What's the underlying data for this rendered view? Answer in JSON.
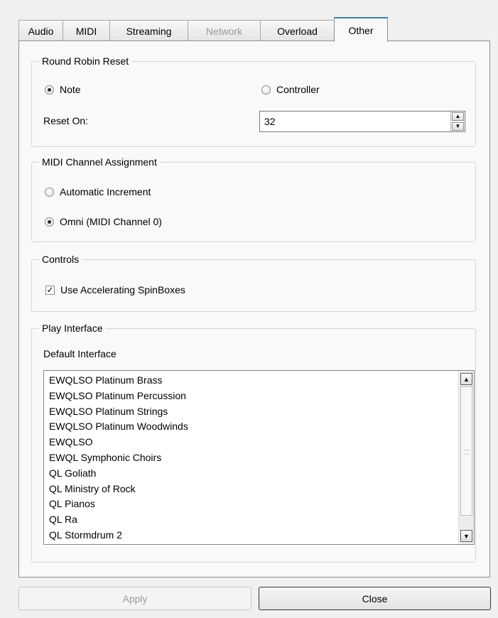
{
  "tabs": [
    {
      "label": "Audio",
      "state": "normal"
    },
    {
      "label": "MIDI",
      "state": "normal"
    },
    {
      "label": "Streaming",
      "state": "normal"
    },
    {
      "label": "Network",
      "state": "disabled"
    },
    {
      "label": "Overload",
      "state": "normal"
    },
    {
      "label": "Other",
      "state": "active"
    }
  ],
  "round_robin": {
    "title": "Round Robin Reset",
    "note_label": "Note",
    "note_selected": true,
    "controller_label": "Controller",
    "controller_selected": false,
    "reset_on_label": "Reset On:",
    "reset_on_value": "32"
  },
  "midi_channel": {
    "title": "MIDI Channel Assignment",
    "auto_label": "Automatic Increment",
    "auto_selected": false,
    "omni_label": "Omni (MIDI Channel 0)",
    "omni_selected": true
  },
  "controls": {
    "title": "Controls",
    "accel_label": "Use Accelerating SpinBoxes",
    "accel_checked": true
  },
  "play_interface": {
    "title": "Play Interface",
    "default_label": "Default Interface",
    "items": [
      "EWQLSO Platinum Brass",
      "EWQLSO Platinum Percussion",
      "EWQLSO Platinum Strings",
      "EWQLSO Platinum Woodwinds",
      "EWQLSO",
      "EWQL Symphonic Choirs",
      "QL Goliath",
      "QL Ministry of Rock",
      "QL Pianos",
      "QL Ra",
      "QL Stormdrum 2"
    ],
    "scroll_position": 0
  },
  "buttons": {
    "apply": "Apply",
    "close": "Close"
  },
  "icons": {
    "scroll_up": "scroll-up-arrow-icon",
    "scroll_down": "scroll-down-arrow-icon",
    "spin_up": "spin-up-arrow-icon",
    "spin_down": "spin-down-arrow-icon",
    "check": "checkmark-icon"
  },
  "colors": {
    "active_tab_accent": "#3c7fb1",
    "window_bg": "#f0f0f0",
    "panel_bg": "#f9f9f9"
  }
}
